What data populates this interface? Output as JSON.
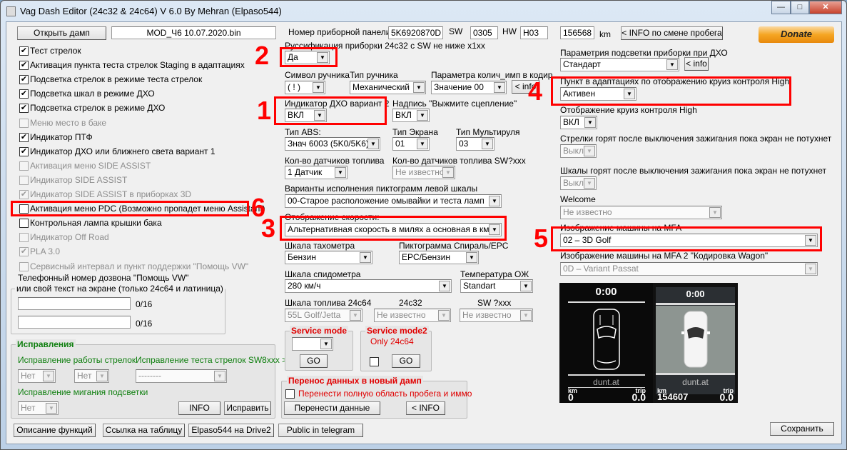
{
  "window": {
    "title": "Vag Dash Editor (24c32 & 24c64) V 6.0  By Mehran (Elpaso544)",
    "controls": [
      "minimize",
      "maximize",
      "close"
    ]
  },
  "top": {
    "open_dump": "Открыть дамп",
    "filename": "MOD_Ч6 10.07.2020.bin",
    "panel_label": "Номер приборной панели:",
    "panel_number": "5K6920870D",
    "sw_label": "SW",
    "sw": "0305",
    "hw_label": "HW",
    "hw": "H03",
    "mileage": "156568",
    "km": "km",
    "mileage_info": "< INFO по смене пробега",
    "donate": "Donate"
  },
  "checkboxes": [
    {
      "label": "Тест стрелок",
      "checked": true,
      "enabled": true
    },
    {
      "label": "Активация пункта теста стрелок Staging в адаптациях",
      "checked": true,
      "enabled": true
    },
    {
      "label": "Подсветка стрелок в режиме теста стрелок",
      "checked": true,
      "enabled": true
    },
    {
      "label": "Подсветка шкал в режиме ДХО",
      "checked": true,
      "enabled": true
    },
    {
      "label": "Подсветка стрелок в режиме ДХО",
      "checked": true,
      "enabled": true
    },
    {
      "label": "Меню место в баке",
      "checked": false,
      "enabled": false
    },
    {
      "label": "Индикатор ПТФ",
      "checked": true,
      "enabled": true
    },
    {
      "label": "Индикатор  ДХО или  ближнего света  вариант 1",
      "checked": true,
      "enabled": true
    },
    {
      "label": "Активация меню SIDE ASSIST",
      "checked": false,
      "enabled": false
    },
    {
      "label": "Индикатор SIDE ASSIST",
      "checked": false,
      "enabled": false
    },
    {
      "label": "Индикатор SIDE ASSIST в приборках 3D",
      "checked": true,
      "enabled": false
    },
    {
      "label": "Активация меню PDC (Возможно пропадет меню Assistant)",
      "checked": false,
      "enabled": true
    },
    {
      "label": "Контрольная лампа крышки бака",
      "checked": false,
      "enabled": true
    },
    {
      "label": "Индикатор Off Road",
      "checked": false,
      "enabled": false
    },
    {
      "label": "PLA 3.0",
      "checked": true,
      "enabled": false
    },
    {
      "label": "Сервисный интервал и пункт поддержки \"Помощь VW\"",
      "checked": false,
      "enabled": false
    }
  ],
  "phone": {
    "label": "Телефонный номер дозвона \"Помощь VW\"",
    "legend": "или свой текст на экране (только 24c64 и латиница)",
    "line1": "",
    "line2": "",
    "count1": "0/16",
    "count2": "0/16"
  },
  "fixes": {
    "legend": "Исправления",
    "needles_label": "Исправление работы стрелок",
    "needles_a": "Нет",
    "needles_b": "Нет",
    "test_label": "Исправление теста стрелок SW8xxx >",
    "test_value": "--------",
    "blink_label": "Исправление мигания подсветки",
    "blink_value": "Нет",
    "info": "INFO",
    "fix": "Исправить"
  },
  "bottom": {
    "functions": "Описание функций",
    "table_link": "Ссылка на таблицу",
    "drive2": "Elpaso544 на Drive2",
    "telegram": "Public in telegram",
    "save": "Сохранить"
  },
  "mid": {
    "russ_label": "Руссификация приборки 24c32 с SW не ниже x1xx",
    "russ": "Да",
    "handbrake_sym_label": "Символ ручника",
    "handbrake_sym": "( ! )",
    "handbrake_type_label": "Тип ручника",
    "handbrake_type": "Механический",
    "imp_label": "Параметра колич_имп в кодир.",
    "imp": "Значение 00",
    "imp_info": "< info",
    "drl2_label": "Индикатор ДХО вариант 2",
    "drl2": "ВКЛ",
    "clutch_label": "Надпись \"Выжмите сцепление\"",
    "clutch": "ВКЛ",
    "abs_label": "Тип ABS:",
    "abs": "Знач 6003 (5K0/5K6)",
    "screen_label": "Тип Экрана",
    "screen": "01",
    "mfsw_label": "Тип Мультируля",
    "mfsw": "03",
    "fuel_sensors_label": "Кол-во датчиков топлива",
    "fuel_sensors": "1 Датчик",
    "fuel_sensors_sw_label": "Кол-во датчиков топлива SW?xxx",
    "fuel_sensors_sw": "Не известно",
    "pict_label": "Варианты исполнения пиктограмм левой шкалы",
    "pict": "00-Старое расположение омывайки и теста ламп",
    "speed_label": "Отображение скорости:",
    "speed": "Альтернативная скорость в милях а основная в км",
    "tacho_label": "Шкала тахометра",
    "tacho": "Бензин",
    "epc_label": "Пиктограмма Спираль/EPC",
    "epc": "EPC/Бензин",
    "speedo_label": "Шкала спидометра",
    "speedo": "280 км/ч",
    "temp_label": "Температура ОЖ",
    "temp": "Standart",
    "fuel64_label": "Шкала топлива 24c64",
    "fuel64": "55L Golf/Jetta",
    "fuel32_label": "24c32",
    "fuel32": "Не известно",
    "fuelsw_label": "SW ?xxx",
    "fuelsw": "Не известно"
  },
  "service": {
    "mode1": "Service mode",
    "mode1_value": "",
    "go1": "GO",
    "mode2": "Service mode2",
    "only": "Only 24c64",
    "go2": "GO"
  },
  "transfer": {
    "legend": "Перенос данных в новый дамп",
    "full_area": "Перенести полную область пробега и иммо",
    "transfer_btn": "Перенести данные",
    "info": "< INFO"
  },
  "right": {
    "drl_param_label": "Параметрия подсветки приборки при ДХО",
    "drl_param": "Стандарт",
    "drl_info": "< info",
    "cc_adapt_label": "Пункт в адаптациях по отображению круиз контроля High",
    "cc_adapt": "Активен",
    "cc_show_label": "Отображение круиз контроля High",
    "cc_show": "ВКЛ",
    "needles_after_label": "Стрелки горят после выключения зажигания пока экран не потухнет",
    "needles_after": "Выкл",
    "scales_after_label": "Шкалы горят после выключения зажигания пока экран не потухнет",
    "scales_after": "Выкл",
    "welcome_label": "Welcome",
    "welcome": "Не известно",
    "mfa_label": "Изображение машины на MFA",
    "mfa": "02 – 3D Golf",
    "mfa2_label": "Изображение машины на MFA 2  \"Кодировка Wagon\"",
    "mfa2": "0D – Variant Passat"
  },
  "preview": {
    "left": {
      "time": "0:00",
      "brand": "dunt.at",
      "km_label": "km",
      "km": "0",
      "trip_label": "trip",
      "trip": "0.0"
    },
    "right": {
      "time": "0:00",
      "brand": "dunt.at",
      "km_label": "km",
      "km": "154607",
      "trip_label": "trip",
      "trip": "0.0"
    }
  },
  "annotations": [
    "1",
    "2",
    "3",
    "4",
    "5",
    "6"
  ],
  "colors": {
    "annotation": "#ff0000",
    "legend_red": "#e00000",
    "legend_green": "#0f7f0f",
    "donate": "#f5a623"
  }
}
